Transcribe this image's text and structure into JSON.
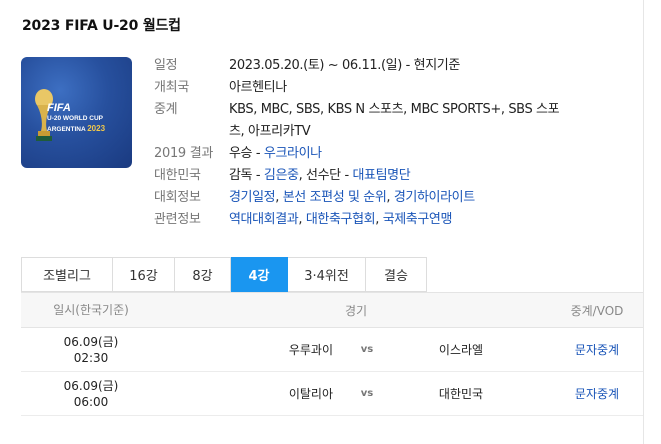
{
  "title": "2023 FIFA U-20 월드컵",
  "poster": {
    "line1": "FIFA",
    "line2": "U-20 WORLD CUP",
    "line3": "ARGENTINA",
    "line3_year": "2023"
  },
  "info": {
    "schedule": {
      "label": "일정",
      "value": "2023.05.20.(토) ~ 06.11.(일) - 현지기준"
    },
    "host": {
      "label": "개최국",
      "value": "아르헨티나"
    },
    "broadcast": {
      "label": "중계",
      "value_line1": "KBS, MBC, SBS, KBS N 스포츠, MBC SPORTS+, SBS 스포",
      "value_line2": "츠, 아프리카TV"
    },
    "result2019": {
      "label": "2019 결과",
      "prefix": "우승 - ",
      "link": "우크라이나"
    },
    "korea": {
      "label": "대한민국",
      "coach_prefix": "감독 - ",
      "coach": "김은중",
      "sep": ", 선수단 - ",
      "roster": "대표팀명단"
    },
    "tournament": {
      "label": "대회정보",
      "link1": "경기일정",
      "sep1": ", ",
      "link2": "본선 조편성 및 순위",
      "sep2": ", ",
      "link3": "경기하이라이트"
    },
    "related": {
      "label": "관련정보",
      "link1": "역대대회결과",
      "sep1": ", ",
      "link2": "대한축구협회",
      "sep2": ", ",
      "link3": "국제축구연맹"
    }
  },
  "tabs": [
    {
      "label": "조별리그"
    },
    {
      "label": "16강"
    },
    {
      "label": "8강"
    },
    {
      "label": "4강"
    },
    {
      "label": "3·4위전"
    },
    {
      "label": "결승"
    }
  ],
  "table": {
    "headers": {
      "date": "일시(한국기준)",
      "match": "경기",
      "media": "중계/VOD"
    },
    "rows": [
      {
        "date": "06.09(금)",
        "time": "02:30",
        "home": "우루과이",
        "vs": "vs",
        "away": "이스라엘",
        "media": "문자중계"
      },
      {
        "date": "06.09(금)",
        "time": "06:00",
        "home": "이탈리아",
        "vs": "vs",
        "away": "대한민국",
        "media": "문자중계"
      }
    ]
  },
  "colors": {
    "accent": "#1a96f0",
    "link": "#1a55b8"
  }
}
